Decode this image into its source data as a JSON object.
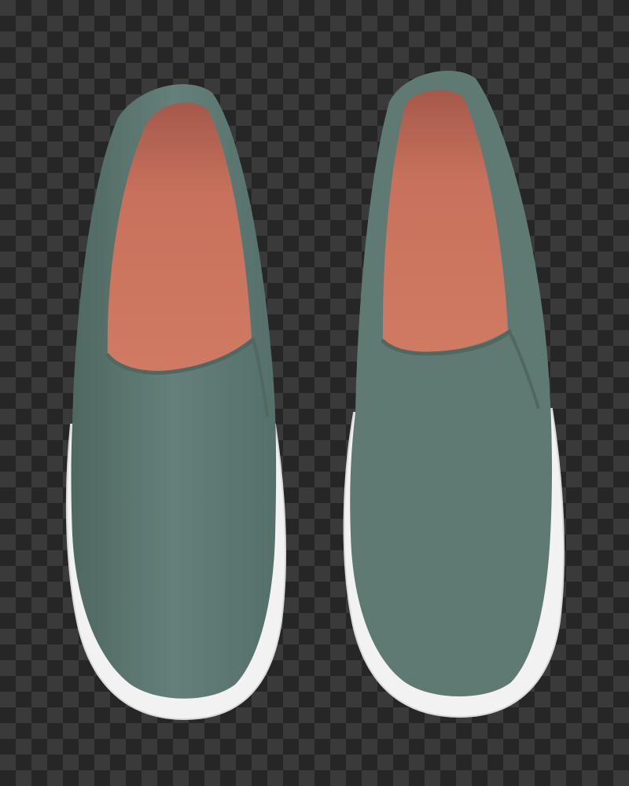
{
  "image": {
    "subject": "",
    "colors": {
      "checker_light": "#3a3a3a",
      "checker_dark": "#262626",
      "upper": "#5f7a72",
      "upper_shadow": "#4f6861",
      "upper_highlight": "#6d887f",
      "lining": "#c8725d",
      "lining_shadow": "#a5594a",
      "sole": "#f2f2f2",
      "sole_shadow": "#d9d9d9"
    }
  }
}
